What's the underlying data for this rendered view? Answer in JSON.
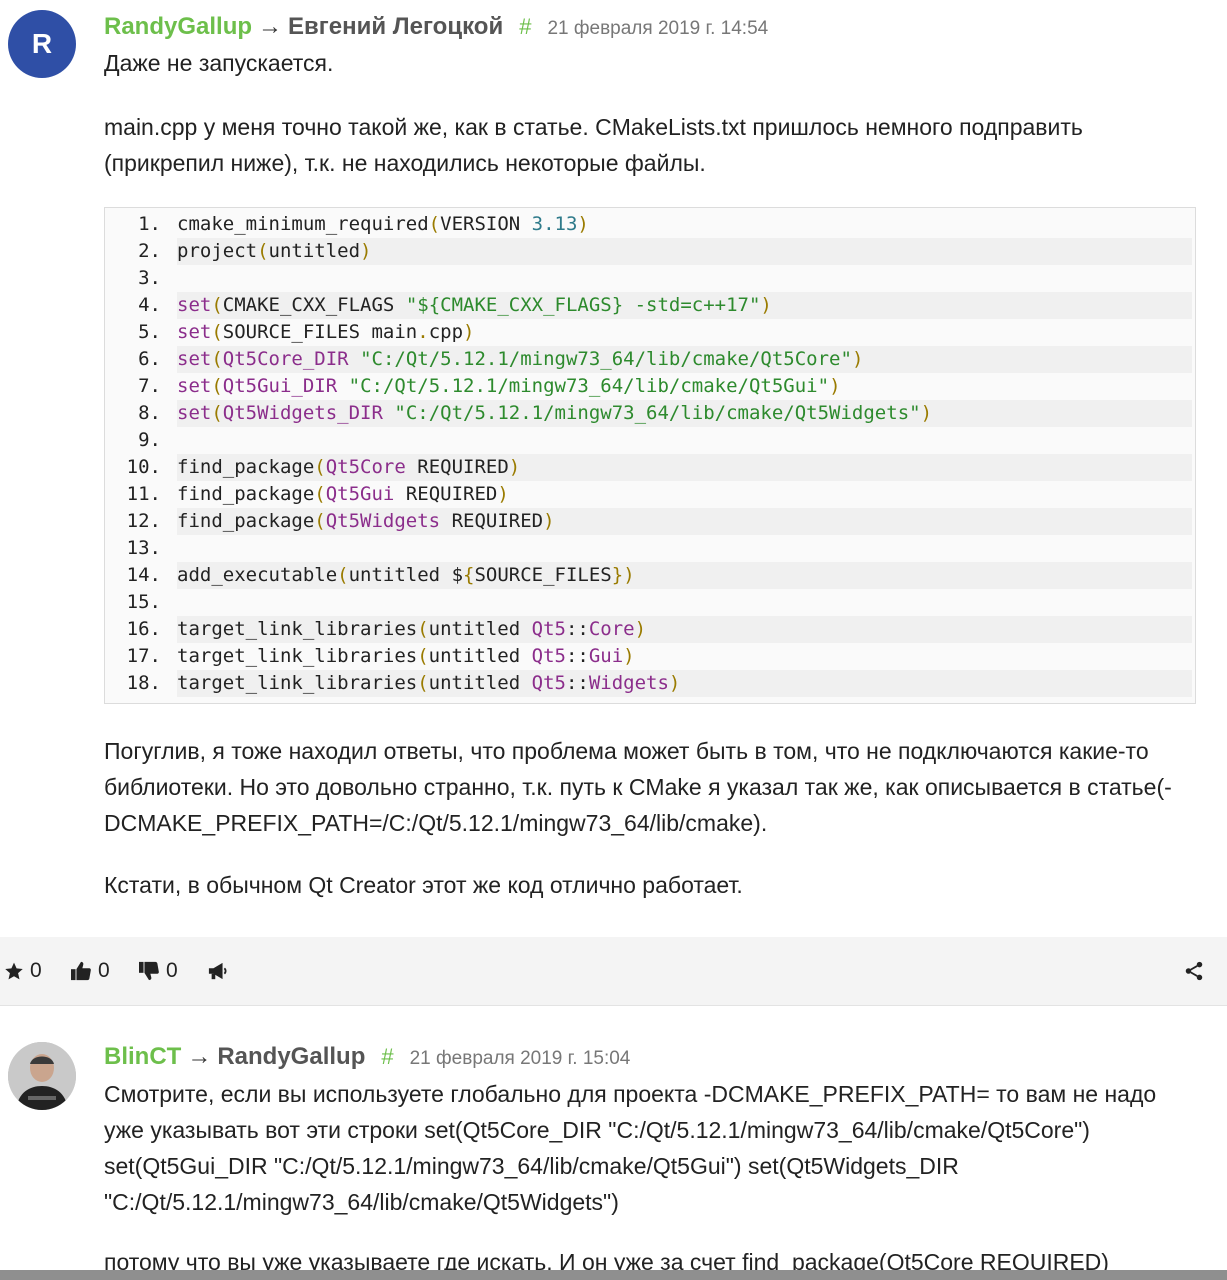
{
  "comments": [
    {
      "avatar_letter": "R",
      "author": "RandyGallup",
      "arrow": "→",
      "recipient": "Евгений Легоцкой",
      "hash": "#",
      "date": "21 февраля 2019 г. 14:54",
      "paragraphs": [
        "Даже не запускается.",
        "main.cpp у меня точно такой же, как в статье. CMakeLists.txt пришлось немного подправить (прикрепил ниже), т.к. не находились некоторые файлы.",
        "Погуглив, я тоже находил ответы, что проблема может быть в том, что не подключаются какие-то библиотеки. Но это довольно странно, т.к. путь к CMake я указал так же, как описывается в статье(-DCMAKE_PREFIX_PATH=/C:/Qt/5.12.1/mingw73_64/lib/cmake).",
        "Кстати, в обычном Qt Creator этот же код отлично работает."
      ],
      "code_lines": [
        "1.",
        "2.",
        "3.",
        "4.",
        "5.",
        "6.",
        "7.",
        "8.",
        "9.",
        "10.",
        "11.",
        "12.",
        "13.",
        "14.",
        "15.",
        "16.",
        "17.",
        "18."
      ]
    },
    {
      "author": "BlinCT",
      "arrow": "→",
      "recipient": "RandyGallup",
      "hash": "#",
      "date": "21 февраля 2019 г. 15:04",
      "paragraphs": [
        "Смотрите, если вы используете глобально для проекта -DCMAKE_PREFIX_PATH= то вам не надо уже указывать вот эти строки set(Qt5Core_DIR \"C:/Qt/5.12.1/mingw73_64/lib/cmake/Qt5Core\") set(Qt5Gui_DIR \"C:/Qt/5.12.1/mingw73_64/lib/cmake/Qt5Gui\") set(Qt5Widgets_DIR \"C:/Qt/5.12.1/mingw73_64/lib/cmake/Qt5Widgets\")",
        "потому что вы уже указываете где искать. И он уже за счет find_package(Qt5Core REQUIRED)"
      ]
    }
  ],
  "toolbar": {
    "star_count": "0",
    "like_count": "0",
    "dislike_count": "0"
  },
  "icons": {
    "star": "star-icon",
    "like": "thumbs-up-icon",
    "dislike": "thumbs-down-icon",
    "reply": "megaphone-icon",
    "share": "share-icon"
  },
  "colors": {
    "author": "#6dbf4b",
    "avatar_bg": "#2f4fa6",
    "keyword": "#8b2d8b",
    "string": "#2d8a2d",
    "number": "#2e7a8a"
  },
  "code": [
    [
      {
        "t": "cmake_minimum_required",
        "c": ""
      },
      {
        "t": "(",
        "c": "par"
      },
      {
        "t": "VERSION ",
        "c": ""
      },
      {
        "t": "3.13",
        "c": "num"
      },
      {
        "t": ")",
        "c": "par"
      }
    ],
    [
      {
        "t": "project",
        "c": ""
      },
      {
        "t": "(",
        "c": "par"
      },
      {
        "t": "untitled",
        "c": ""
      },
      {
        "t": ")",
        "c": "par"
      }
    ],
    [],
    [
      {
        "t": "set",
        "c": "kw"
      },
      {
        "t": "(",
        "c": "par"
      },
      {
        "t": "CMAKE_CXX_FLAGS ",
        "c": ""
      },
      {
        "t": "\"${CMAKE_CXX_FLAGS} -std=c++17\"",
        "c": "str"
      },
      {
        "t": ")",
        "c": "par"
      }
    ],
    [
      {
        "t": "set",
        "c": "kw"
      },
      {
        "t": "(",
        "c": "par"
      },
      {
        "t": "SOURCE_FILES main",
        "c": ""
      },
      {
        "t": ".",
        "c": "par"
      },
      {
        "t": "cpp",
        "c": ""
      },
      {
        "t": ")",
        "c": "par"
      }
    ],
    [
      {
        "t": "set",
        "c": "kw"
      },
      {
        "t": "(",
        "c": "par"
      },
      {
        "t": "Qt5Core_DIR ",
        "c": "kw"
      },
      {
        "t": "\"C:/Qt/5.12.1/mingw73_64/lib/cmake/Qt5Core\"",
        "c": "str"
      },
      {
        "t": ")",
        "c": "par"
      }
    ],
    [
      {
        "t": "set",
        "c": "kw"
      },
      {
        "t": "(",
        "c": "par"
      },
      {
        "t": "Qt5Gui_DIR ",
        "c": "kw"
      },
      {
        "t": "\"C:/Qt/5.12.1/mingw73_64/lib/cmake/Qt5Gui\"",
        "c": "str"
      },
      {
        "t": ")",
        "c": "par"
      }
    ],
    [
      {
        "t": "set",
        "c": "kw"
      },
      {
        "t": "(",
        "c": "par"
      },
      {
        "t": "Qt5Widgets_DIR ",
        "c": "kw"
      },
      {
        "t": "\"C:/Qt/5.12.1/mingw73_64/lib/cmake/Qt5Widgets\"",
        "c": "str"
      },
      {
        "t": ")",
        "c": "par"
      }
    ],
    [],
    [
      {
        "t": "find_package",
        "c": ""
      },
      {
        "t": "(",
        "c": "par"
      },
      {
        "t": "Qt5Core",
        "c": "kw"
      },
      {
        "t": " REQUIRED",
        "c": ""
      },
      {
        "t": ")",
        "c": "par"
      }
    ],
    [
      {
        "t": "find_package",
        "c": ""
      },
      {
        "t": "(",
        "c": "par"
      },
      {
        "t": "Qt5Gui",
        "c": "kw"
      },
      {
        "t": " REQUIRED",
        "c": ""
      },
      {
        "t": ")",
        "c": "par"
      }
    ],
    [
      {
        "t": "find_package",
        "c": ""
      },
      {
        "t": "(",
        "c": "par"
      },
      {
        "t": "Qt5Widgets",
        "c": "kw"
      },
      {
        "t": " REQUIRED",
        "c": ""
      },
      {
        "t": ")",
        "c": "par"
      }
    ],
    [],
    [
      {
        "t": "add_executable",
        "c": ""
      },
      {
        "t": "(",
        "c": "par"
      },
      {
        "t": "untitled ",
        "c": ""
      },
      {
        "t": "$",
        "c": ""
      },
      {
        "t": "{",
        "c": "par"
      },
      {
        "t": "SOURCE_FILES",
        "c": ""
      },
      {
        "t": "})",
        "c": "par"
      }
    ],
    [],
    [
      {
        "t": "target_link_libraries",
        "c": ""
      },
      {
        "t": "(",
        "c": "par"
      },
      {
        "t": "untitled ",
        "c": ""
      },
      {
        "t": "Qt5",
        "c": "kw"
      },
      {
        "t": "::",
        "c": ""
      },
      {
        "t": "Core",
        "c": "kw"
      },
      {
        "t": ")",
        "c": "par"
      }
    ],
    [
      {
        "t": "target_link_libraries",
        "c": ""
      },
      {
        "t": "(",
        "c": "par"
      },
      {
        "t": "untitled ",
        "c": ""
      },
      {
        "t": "Qt5",
        "c": "kw"
      },
      {
        "t": "::",
        "c": ""
      },
      {
        "t": "Gui",
        "c": "kw"
      },
      {
        "t": ")",
        "c": "par"
      }
    ],
    [
      {
        "t": "target_link_libraries",
        "c": ""
      },
      {
        "t": "(",
        "c": "par"
      },
      {
        "t": "untitled ",
        "c": ""
      },
      {
        "t": "Qt5",
        "c": "kw"
      },
      {
        "t": "::",
        "c": ""
      },
      {
        "t": "Widgets",
        "c": "kw"
      },
      {
        "t": ")",
        "c": "par"
      }
    ]
  ]
}
